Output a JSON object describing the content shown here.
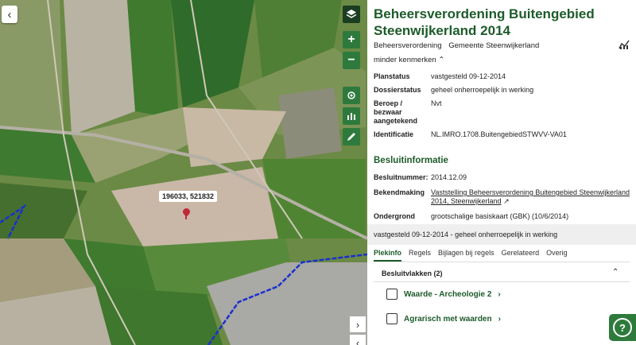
{
  "map": {
    "back_icon": "‹",
    "coordinate_label": "196033, 521832",
    "tools": {
      "layers_icon": "layers-icon",
      "zoom_in": "+",
      "zoom_out": "−",
      "locate_icon": "locate-icon",
      "chart_icon": "chart-icon",
      "edit_icon": "pencil-icon"
    },
    "nav_next": "›",
    "nav_prev": "‹"
  },
  "panel": {
    "title": "Beheersverordening Buitengebied Steenwijkerland 2014",
    "type": "Beheersverordening",
    "authority": "Gemeente Steenwijkerland",
    "minder": "minder kenmerken",
    "props": {
      "planstatus_k": "Planstatus",
      "planstatus_v": "vastgesteld 09-12-2014",
      "dossier_k": "Dossierstatus",
      "dossier_v": "geheel onherroepelijk in werking",
      "beroep_k": "Beroep / bezwaar aangetekend",
      "beroep_v": "Nvt",
      "ident_k": "Identificatie",
      "ident_v": "NL.IMRO.1708.BuitengebiedSTWVV-VA01"
    },
    "besluit_title": "Besluitinformatie",
    "besluit": {
      "nummer_k": "Besluitnummer:",
      "nummer_v": "2014.12.09",
      "bekend_k": "Bekendmaking",
      "bekend_v": "Vaststelling Beheersverordening Buitengebied Steenwijkerland 2014, Steenwijkerland",
      "onder_k": "Ondergrond",
      "onder_v": "grootschalige basiskaart (GBK) (10/6/2014)"
    },
    "status_line": "vastgesteld 09-12-2014 - geheel onherroepelijk in werking",
    "tabs": [
      "Plekinfo",
      "Regels",
      "Bijlagen bij regels",
      "Gerelateerd",
      "Overig"
    ],
    "accordion": {
      "header": "Besluitvlakken (2)",
      "items": [
        "Waarde - Archeologie 2",
        "Agrarisch met waarden"
      ]
    },
    "help": "?"
  }
}
